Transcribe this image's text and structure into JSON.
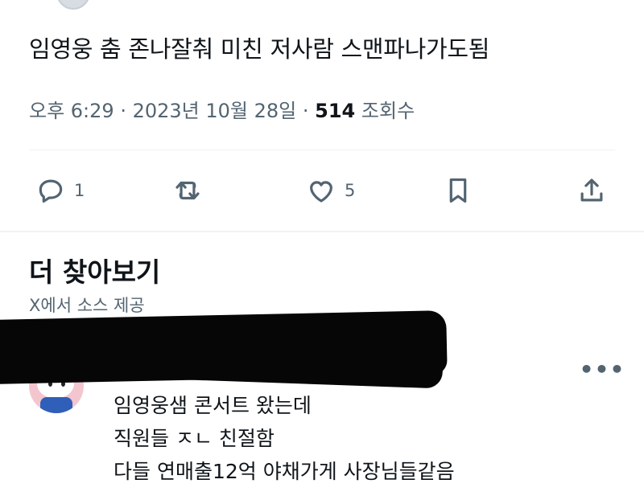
{
  "tweet": {
    "text": "임영웅 춤 존나잘춰 미친 저사람 스맨파나가도됨",
    "time": "오후 6:29",
    "date": "2023년 10월 28일",
    "views_count": "514",
    "views_label": "조회수"
  },
  "actions": {
    "reply_count": "1",
    "like_count": "5",
    "icons": [
      "reply-icon",
      "retweet-icon",
      "like-icon",
      "bookmark-icon",
      "share-icon"
    ]
  },
  "more_section": {
    "title": "더 찾아보기",
    "source": "X에서 소스 제공"
  },
  "reply": {
    "lines": [
      "임영웅샘 콘서트 왔는데",
      "직원들 ㅈㄴ 친절함",
      "다들 연매출12억 야채가게 사장님들같음"
    ],
    "more_label": "•••"
  },
  "colors": {
    "text": "#0f1419",
    "secondary": "#536471",
    "divider": "#eff3f4",
    "redaction": "#060606"
  }
}
